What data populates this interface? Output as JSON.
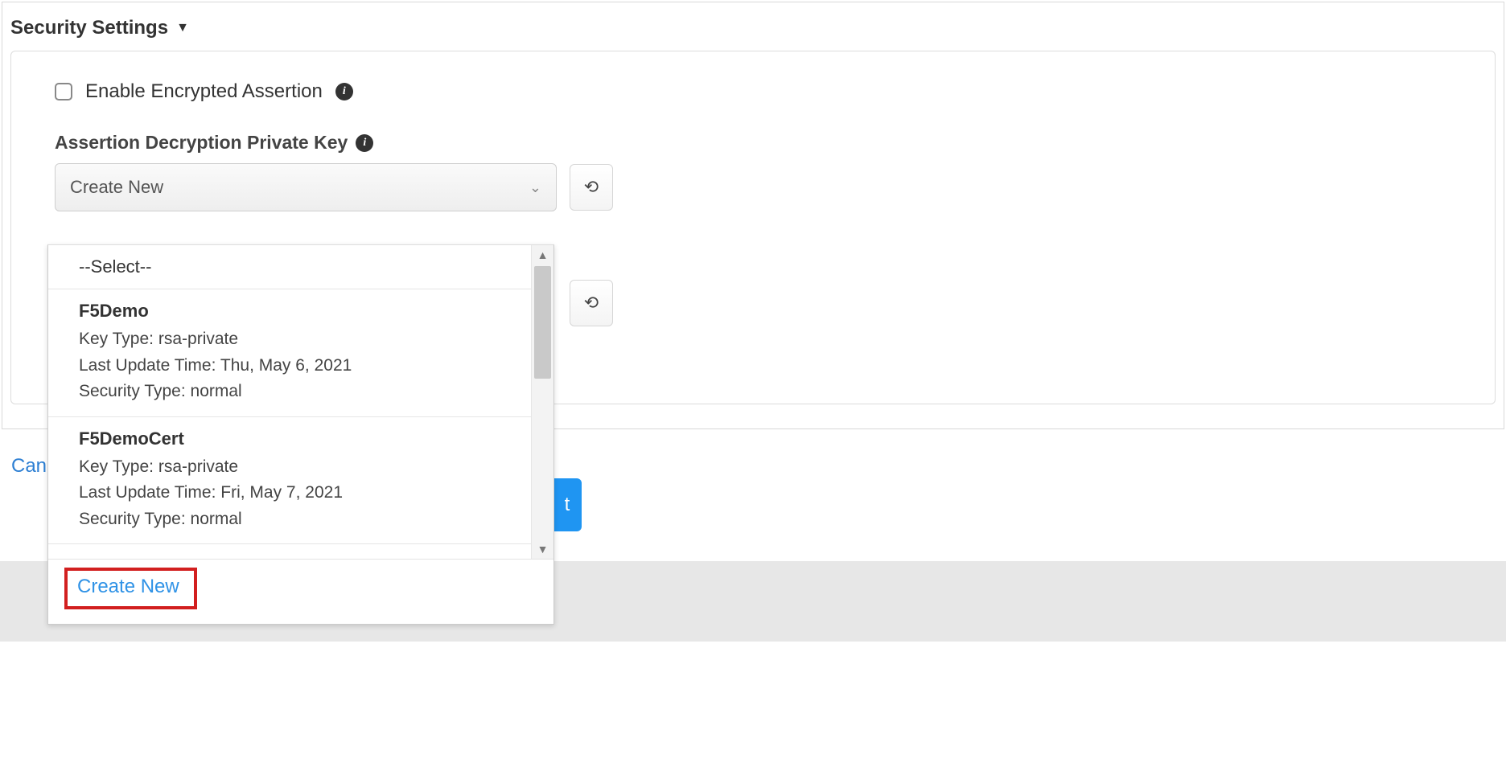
{
  "section_title": "Security Settings",
  "checkbox_label": "Enable Encrypted Assertion",
  "field_label": "Assertion Decryption Private Key",
  "select_value": "Create New",
  "dropdown": {
    "placeholder": "--Select--",
    "options": [
      {
        "name": "F5Demo",
        "key_type_label": "Key Type:",
        "key_type": "rsa-private",
        "last_update_label": "Last Update Time:",
        "last_update": "Thu, May 6, 2021",
        "security_type_label": "Security Type:",
        "security_type": "normal"
      },
      {
        "name": "F5DemoCert",
        "key_type_label": "Key Type:",
        "key_type": "rsa-private",
        "last_update_label": "Last Update Time:",
        "last_update": "Fri, May 7, 2021",
        "security_type_label": "Security Type:",
        "security_type": "normal"
      }
    ],
    "create_new": "Create New"
  },
  "buttons": {
    "cancel": "Can",
    "next_fragment": "t"
  }
}
